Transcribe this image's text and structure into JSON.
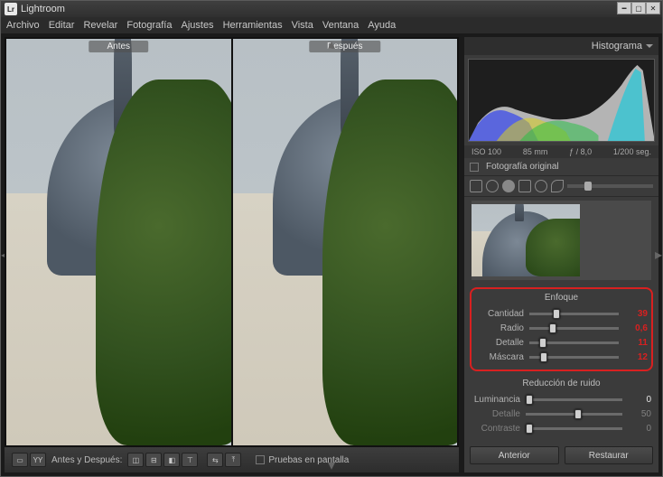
{
  "app": {
    "title": "Lightroom",
    "badge": "Lr"
  },
  "menu": [
    "Archivo",
    "Editar",
    "Revelar",
    "Fotografía",
    "Ajustes",
    "Herramientas",
    "Vista",
    "Ventana",
    "Ayuda"
  ],
  "preview": {
    "before_label": "Antes",
    "after_label": "Después"
  },
  "toolbar": {
    "compare_label": "Antes y Después:",
    "softproof_label": "Pruebas en pantalla"
  },
  "panels": {
    "histogram": {
      "title": "Histograma",
      "iso": "ISO 100",
      "focal": "85 mm",
      "aperture": "ƒ / 8,0",
      "shutter": "1/200 seg.",
      "original_label": "Fotografía original"
    },
    "enfoque": {
      "title": "Enfoque",
      "rows": [
        {
          "label": "Cantidad",
          "value": "39",
          "pct": 26
        },
        {
          "label": "Radio",
          "value": "0,6",
          "pct": 22
        },
        {
          "label": "Detalle",
          "value": "11",
          "pct": 11
        },
        {
          "label": "Máscara",
          "value": "12",
          "pct": 12
        }
      ]
    },
    "ruido": {
      "title": "Reducción de ruido",
      "rows": [
        {
          "label": "Luminancia",
          "value": "0",
          "pct": 0
        },
        {
          "label": "Detalle",
          "value": "50",
          "pct": 50
        },
        {
          "label": "Contraste",
          "value": "0",
          "pct": 0
        }
      ]
    },
    "footer": {
      "prev": "Anterior",
      "restore": "Restaurar"
    }
  }
}
